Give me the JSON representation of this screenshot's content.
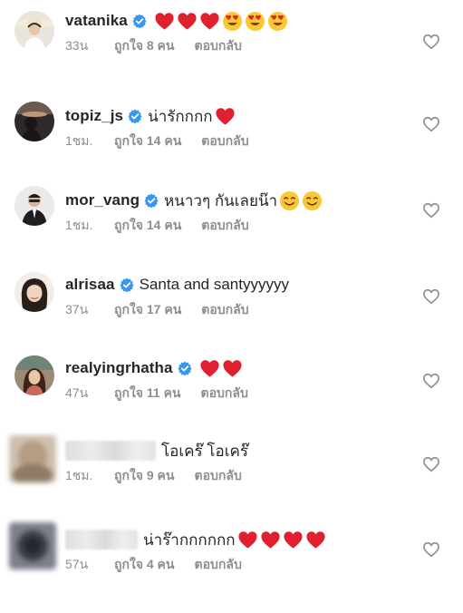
{
  "comments": [
    {
      "username": "vatanika",
      "verified": true,
      "text": "",
      "emojis": [
        "heart",
        "heart",
        "heart",
        "heart-eyes",
        "heart-eyes",
        "heart-eyes"
      ],
      "time": "33น",
      "likes": "ถูกใจ 8 คน",
      "reply": "ตอบกลับ",
      "avatar": "avatar-vatanika",
      "blurred": false
    },
    {
      "username": "topiz_js",
      "verified": true,
      "text": "น่ารักกกก",
      "emojis": [
        "heart"
      ],
      "time": "1ชม.",
      "likes": "ถูกใจ 14 คน",
      "reply": "ตอบกลับ",
      "avatar": "avatar-topiz",
      "blurred": false
    },
    {
      "username": "mor_vang",
      "verified": true,
      "text": "หนาวๆ กันเลยน๊า",
      "emojis": [
        "smile",
        "smile"
      ],
      "time": "1ชม.",
      "likes": "ถูกใจ 14 คน",
      "reply": "ตอบกลับ",
      "avatar": "avatar-mor-vang",
      "blurred": false
    },
    {
      "username": "alrisaa",
      "verified": true,
      "text": "Santa and santyyyyyy",
      "emojis": [],
      "time": "37น",
      "likes": "ถูกใจ 17 คน",
      "reply": "ตอบกลับ",
      "avatar": "avatar-alrisaa",
      "blurred": false
    },
    {
      "username": "realyingrhatha",
      "verified": true,
      "text": "",
      "emojis": [
        "heart",
        "heart"
      ],
      "time": "47น",
      "likes": "ถูกใจ 11 คน",
      "reply": "ตอบกลับ",
      "avatar": "avatar-realyingrhatha",
      "blurred": false
    },
    {
      "username": "",
      "verified": false,
      "text": "โอเคร๊ โอเคร๊",
      "emojis": [],
      "time": "1ชม.",
      "likes": "ถูกใจ 9 คน",
      "reply": "ตอบกลับ",
      "avatar": "avatar-blurred-1",
      "blurred": true
    },
    {
      "username": "",
      "verified": false,
      "text": "น่าร๊ากกกกกก",
      "emojis": [
        "heart",
        "heart",
        "heart",
        "heart"
      ],
      "time": "57น",
      "likes": "ถูกใจ 4 คน",
      "reply": "ตอบกลับ",
      "avatar": "avatar-blurred-2",
      "blurred": true
    }
  ],
  "colors": {
    "username": "#262626",
    "meta": "#8e8e8e",
    "verified": "#3897f0",
    "heart_emoji": "#e0202e",
    "like_outline": "#8e8e8e"
  },
  "icons": {
    "verified": "verified-badge-icon",
    "like": "heart-outline-icon"
  }
}
